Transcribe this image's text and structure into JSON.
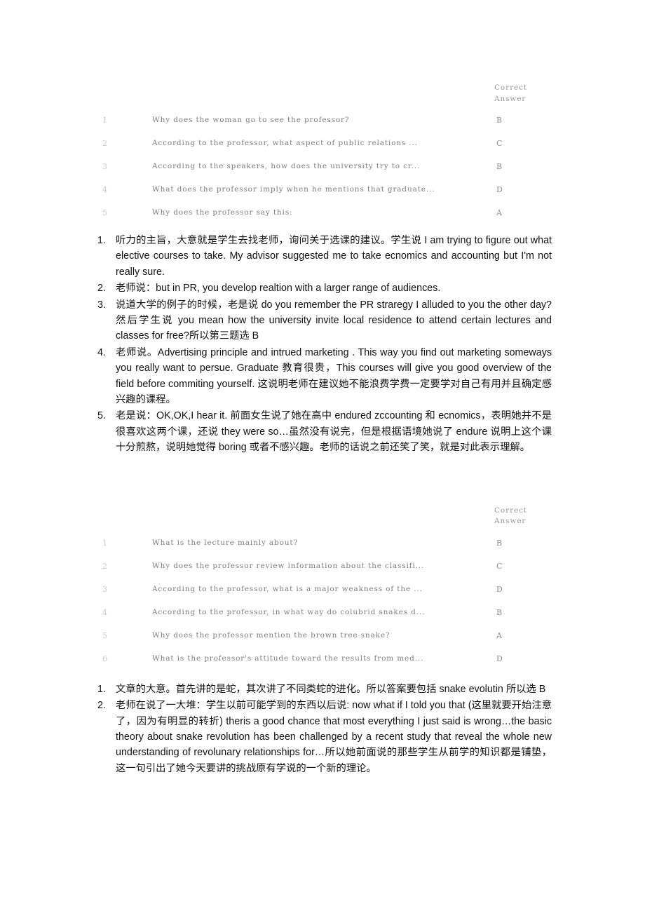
{
  "document": {
    "background_color": "#ffffff",
    "table_text_color": "#7d7d7d",
    "body_text_color": "#111111"
  },
  "sections": [
    {
      "table": {
        "header": {
          "num_col": "",
          "question_col": "",
          "answer_col": "Correct\nAnswer"
        },
        "rows": [
          {
            "num": "1",
            "question": "Why does the woman go to see the professor?",
            "answer": "B"
          },
          {
            "num": "2",
            "question": "According to the professor, what aspect of public relations ...",
            "answer": "C"
          },
          {
            "num": "3",
            "question": "According to the speakers, how does the university try to cr...",
            "answer": "B"
          },
          {
            "num": "4",
            "question": "What does the professor imply when he mentions that graduate...",
            "answer": "D"
          },
          {
            "num": "5",
            "question": "Why does the professor say this:",
            "answer": "A"
          }
        ]
      },
      "notes": [
        {
          "marker": "1.",
          "text": "听力的主旨，大意就是学生去找老师，询问关于选课的建议。学生说 I am trying to figure out what elective courses to take. My advisor suggested me to take ecnomics and accounting but I'm not really sure."
        },
        {
          "marker": "2.",
          "text": "老师说：but in PR, you develop realtion with a larger range of audiences."
        },
        {
          "marker": "3.",
          "text": "说道大学的例子的时候，老是说 do you remember the PR straregy I alluded to you the other day? 然后学生说 you mean how the university invite local residence to attend certain lectures and classes for free?所以第三题选 B"
        },
        {
          "marker": "4.",
          "text": "老师说。Advertising principle and intrued marketing . This way you find out marketing someways you really want to persue. Graduate 教育很贵，This courses will give you good overview of the field before commiting yourself. 这说明老师在建议她不能浪费学费一定要学对自己有用并且确定感兴趣的课程。"
        },
        {
          "marker": "5.",
          "text": "老是说：OK,OK,I hear it. 前面女生说了她在高中 endured zccounting 和 ecnomics，表明她并不是很喜欢这两个课，还说 they were so…虽然没有说完，但是根据语境她说了 endure 说明上这个课十分煎熬，说明她觉得 boring 或者不感兴趣。老师的话说之前还笑了笑，就是对此表示理解。"
        }
      ]
    },
    {
      "table": {
        "header": {
          "num_col": "",
          "question_col": "",
          "answer_col": "Correct\nAnswer"
        },
        "rows": [
          {
            "num": "1",
            "question": "What is the lecture mainly about?",
            "answer": "B"
          },
          {
            "num": "2",
            "question": "Why does the professor review information about the classifi...",
            "answer": "C"
          },
          {
            "num": "3",
            "question": "According to the professor, what is a major weakness of the ...",
            "answer": "D"
          },
          {
            "num": "4",
            "question": "According to the professor, in what way do colubrid snakes d...",
            "answer": "B"
          },
          {
            "num": "5",
            "question": "Why does the professor mention the brown tree snake?",
            "answer": "A"
          },
          {
            "num": "6",
            "question": "What is the professor's attitude toward the results from med...",
            "answer": "D"
          }
        ]
      },
      "notes": [
        {
          "marker": "1.",
          "text": "文章的大意。首先讲的是蛇，其次讲了不同类蛇的进化。所以答案要包括 snake evolutin 所以选 B"
        },
        {
          "marker": "2.",
          "text": "老师在说了一大堆：学生以前可能学到的东西以后说: now what if I told you that (这里就要开始注意了，因为有明显的转折) theris a good chance that most everything I just said is wrong…the basic theory about snake revolution has been challenged by a recent study that reveal the whole new understanding of revolunary relationships for…所以她前面说的那些学生从前学的知识都是铺垫，这一句引出了她今天要讲的挑战原有学说的一个新的理论。"
        }
      ]
    }
  ]
}
